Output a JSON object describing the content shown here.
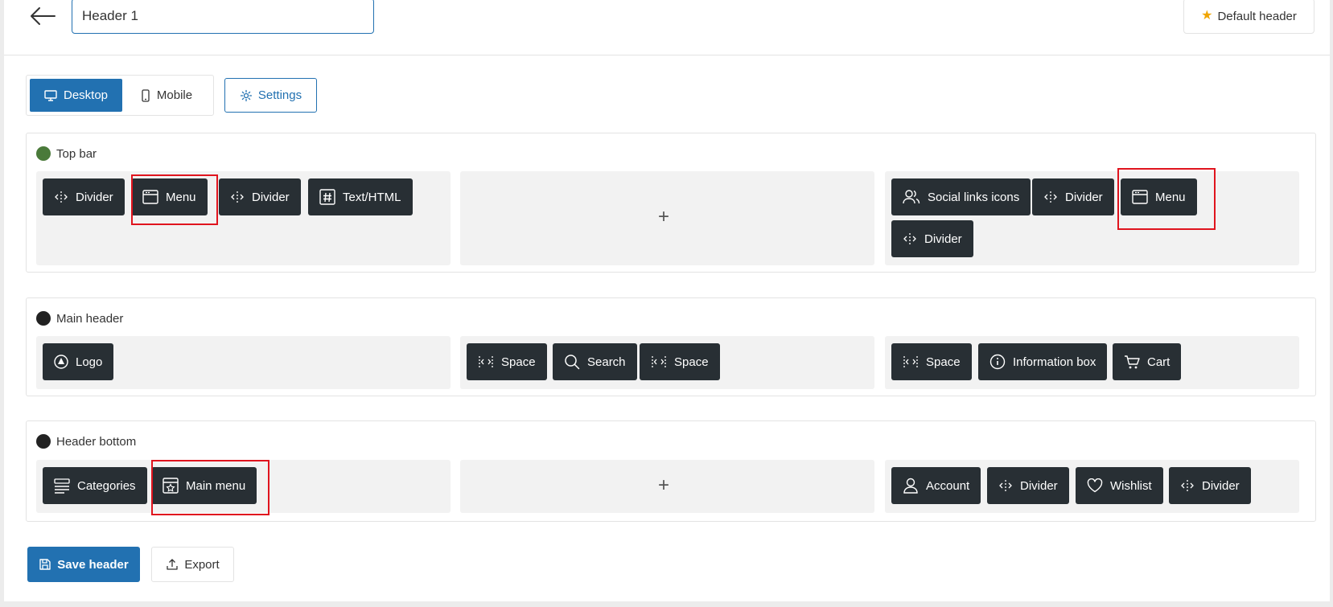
{
  "header": {
    "title_value": "Header 1",
    "default_label": "Default header"
  },
  "devices": {
    "desktop_label": "Desktop",
    "mobile_label": "Mobile",
    "settings_label": "Settings"
  },
  "sections": {
    "top_bar": {
      "title": "Top bar",
      "dot_color": "#4a7a3a",
      "left": [
        "Divider",
        "Menu",
        "Divider",
        "Text/HTML"
      ],
      "right": [
        "Social links icons",
        "Divider",
        "Menu",
        "Divider"
      ]
    },
    "main_header": {
      "title": "Main header",
      "dot_color": "#222222",
      "left": [
        "Logo"
      ],
      "center": [
        "Space",
        "Search",
        "Space"
      ],
      "right": [
        "Space",
        "Information box",
        "Cart"
      ]
    },
    "header_bottom": {
      "title": "Header bottom",
      "dot_color": "#222222",
      "left": [
        "Categories",
        "Main menu"
      ],
      "right": [
        "Account",
        "Divider",
        "Wishlist",
        "Divider"
      ]
    }
  },
  "footer": {
    "save_label": "Save header",
    "export_label": "Export"
  },
  "colors": {
    "accent": "#2271b1",
    "element_bg": "#282f34",
    "highlight": "#e0141e"
  }
}
